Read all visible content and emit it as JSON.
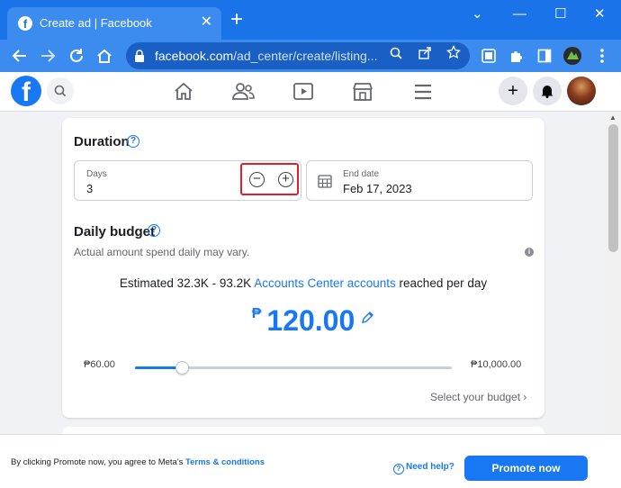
{
  "browser": {
    "tab_title": "Create ad | Facebook",
    "tab_favicon": "f",
    "tab_close": "✕",
    "new_tab": "+",
    "url_host": "facebook.com",
    "url_path": "/ad_center/create/listing..."
  },
  "window": {
    "minimize_glyph": "—",
    "maximize_glyph": "☐",
    "close_glyph": "✕",
    "tabsearch_glyph": "⌄"
  },
  "fb": {
    "logo_glyph": "f",
    "add_glyph": "+",
    "icons": [
      "search-icon",
      "home-icon",
      "friends-icon",
      "watch-icon",
      "marketplace-icon",
      "menu-icon",
      "add-icon",
      "bell-icon"
    ]
  },
  "duration": {
    "title": "Duration",
    "help": "?",
    "days_label": "Days",
    "days_value": "3",
    "minus": "−",
    "plus": "+",
    "end_label": "End date",
    "end_value": "Feb 17, 2023"
  },
  "budget": {
    "title": "Daily budget",
    "help": "?",
    "note": "Actual amount spend daily may vary.",
    "info": "i",
    "estimate_prefix": "Estimated 32.3K - 93.2K ",
    "estimate_link": "Accounts Center accounts",
    "estimate_suffix": " reached per day",
    "currency": "₱",
    "amount": "120.00",
    "min_label": "₱60.00",
    "max_label": "₱10,000.00",
    "slider_fraction": 0.148,
    "select_label": "Select your budget"
  },
  "footer": {
    "agree_text": "By clicking Promote now, you agree to Meta's ",
    "terms_link": "Terms & conditions",
    "help_glyph": "?",
    "need_help": "Need help?",
    "promote_label": "Promote now"
  },
  "colors": {
    "chrome_blue": "#1a73e8",
    "fb_blue": "#1877f2",
    "highlight_red": "#e41e26"
  }
}
